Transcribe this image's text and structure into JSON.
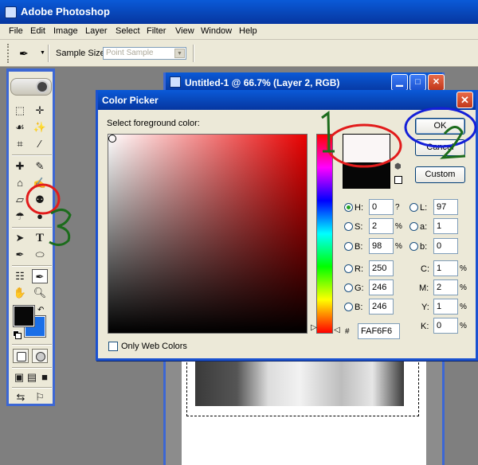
{
  "app": {
    "title": "Adobe Photoshop"
  },
  "menubar": {
    "items": [
      "File",
      "Edit",
      "Image",
      "Layer",
      "Select",
      "Filter",
      "View",
      "Window",
      "Help"
    ]
  },
  "options_bar": {
    "sample_size_label": "Sample Size:",
    "sample_size_value": "Point Sample",
    "tool_icon": "eyedropper-icon"
  },
  "toolbox": {
    "tools": [
      "marquee-icon",
      "move-icon",
      "lasso-icon",
      "magic-wand-icon",
      "crop-icon",
      "slice-icon",
      "healing-brush-icon",
      "brush-icon",
      "clone-stamp-icon",
      "history-brush-icon",
      "eraser-icon",
      "paint-bucket-icon",
      "blur-icon",
      "dodge-icon",
      "path-selection-icon",
      "type-icon",
      "pen-icon",
      "ellipse-shape-icon",
      "notes-icon",
      "eyedropper-icon",
      "hand-icon",
      "zoom-icon"
    ],
    "type_glyph": "T",
    "foreground_color": "#080808",
    "background_color": "#1a6fe8"
  },
  "document": {
    "title": "Untitled-1 @ 66.7% (Layer 2, RGB)"
  },
  "color_picker": {
    "title": "Color Picker",
    "prompt": "Select foreground color:",
    "new_color": "#FAF6F6",
    "current_color": "#060606",
    "buttons": {
      "ok": "OK",
      "cancel": "Cancel",
      "custom": "Custom"
    },
    "hsb": {
      "h": {
        "label": "H:",
        "value": "0",
        "unit": "?"
      },
      "s": {
        "label": "S:",
        "value": "2",
        "unit": "%"
      },
      "b": {
        "label": "B:",
        "value": "98",
        "unit": "%"
      }
    },
    "lab": {
      "l": {
        "label": "L:",
        "value": "97"
      },
      "a": {
        "label": "a:",
        "value": "1"
      },
      "b": {
        "label": "b:",
        "value": "0"
      }
    },
    "rgb": {
      "r": {
        "label": "R:",
        "value": "250"
      },
      "g": {
        "label": "G:",
        "value": "246"
      },
      "b": {
        "label": "B:",
        "value": "246"
      }
    },
    "cmyk": {
      "c": {
        "label": "C:",
        "value": "1",
        "unit": "%"
      },
      "m": {
        "label": "M:",
        "value": "2",
        "unit": "%"
      },
      "y": {
        "label": "Y:",
        "value": "1",
        "unit": "%"
      },
      "k": {
        "label": "K:",
        "value": "0",
        "unit": "%"
      }
    },
    "hex_label": "#",
    "hex": "FAF6F6",
    "only_web_colors": "Only Web Colors",
    "selected_mode": "H"
  },
  "annotations": {
    "one": "1",
    "two": "2",
    "three": "3",
    "color_red": "#e21b1b",
    "color_blue": "#1420d8",
    "color_green": "#1c6c1c"
  }
}
